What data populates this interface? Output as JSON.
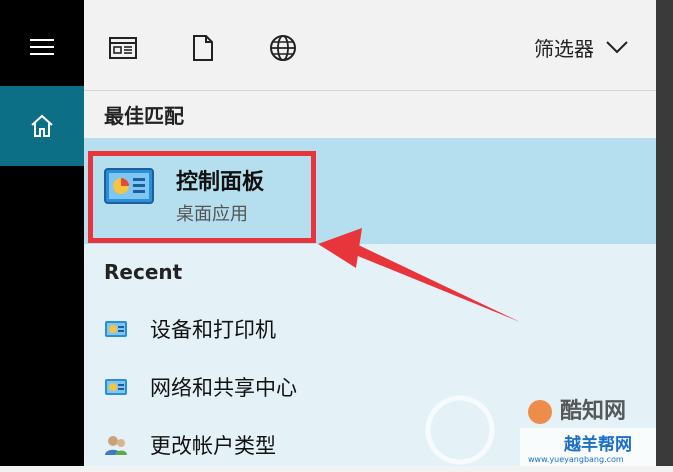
{
  "toolbar": {
    "icons": [
      "document-grid-icon",
      "file-icon",
      "globe-icon"
    ],
    "filter_label": "筛选器"
  },
  "sidebar": {
    "items": [
      "hamburger-menu-icon",
      "home-icon"
    ]
  },
  "best_match": {
    "heading": "最佳匹配",
    "title": "控制面板",
    "subtitle": "桌面应用"
  },
  "recent": {
    "heading": "Recent",
    "items": [
      {
        "label": "设备和打印机",
        "icon": "control-panel-icon"
      },
      {
        "label": "网络和共享中心",
        "icon": "control-panel-icon"
      },
      {
        "label": "更改帐户类型",
        "icon": "users-icon"
      }
    ]
  },
  "watermark": {
    "logo_text": "酷知网",
    "site_text": "越羊帮网",
    "url": "www.yueyangbang.com"
  },
  "colors": {
    "sidebar": "#000000",
    "home_active": "#0d6f86",
    "best_match_bg": "#b5dfee",
    "highlight": "#e8353b",
    "list_bg": "#e4f2f8"
  }
}
